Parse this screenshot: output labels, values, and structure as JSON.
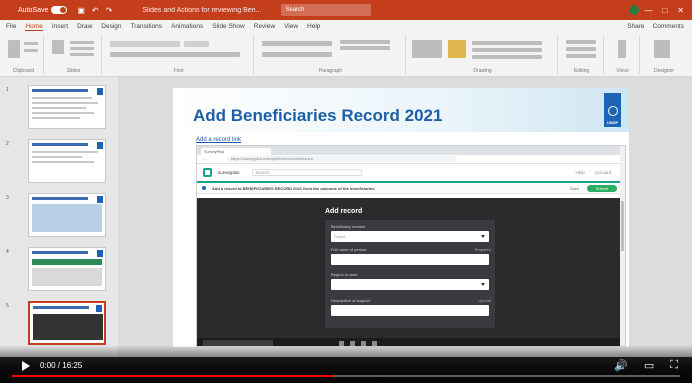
{
  "app": {
    "title_bar": {
      "autosave_label": "AutoSave",
      "document_title": "Slides and Actions for reviewing Ben...",
      "search_placeholder": "Search"
    },
    "menu": {
      "items": [
        "File",
        "Home",
        "Insert",
        "Draw",
        "Design",
        "Transitions",
        "Animations",
        "Slide Show",
        "Review",
        "View",
        "Help"
      ],
      "active_index": 1,
      "share_label": "Share",
      "comments_label": "Comments"
    },
    "ribbon_groups": [
      "Clipboard",
      "Slides",
      "Font",
      "Paragraph",
      "Drawing",
      "Editing",
      "Voice",
      "Designer"
    ]
  },
  "slide_panel": {
    "thumbnails": [
      {
        "number": "1"
      },
      {
        "number": "2"
      },
      {
        "number": "3"
      },
      {
        "number": "4"
      },
      {
        "number": "5",
        "selected": true
      }
    ]
  },
  "slide": {
    "title": "Add Beneficiaries Record 2021",
    "link_text": "Add a record link",
    "logo_text": "UNDP",
    "browser": {
      "tab_label": "SurveyPlus",
      "url": "https://surveyplus.example/forms/beneficiaries",
      "site_name": "surveyplus",
      "search_placeholder": "Search",
      "header_links": [
        "Help",
        "Account"
      ],
      "subheader_title": "Add a record to BENEFICIARIES RECORD 2021 from the outcome of the beneficiaries",
      "back_label": "Back",
      "submit_label": "Submit",
      "modal": {
        "title": "Add record",
        "fields": [
          {
            "label": "Beneficiary number",
            "value": "Select",
            "type": "select"
          },
          {
            "label": "Full name of person",
            "hint": "Required",
            "value": "",
            "type": "text"
          },
          {
            "label": "Region or area",
            "value": "",
            "type": "select"
          },
          {
            "label": "Description of support",
            "hint": "Upload",
            "value": "",
            "type": "text"
          }
        ]
      }
    }
  },
  "video": {
    "timecode": "0:00 / 16:25",
    "progress_fraction": 0.48,
    "controls": [
      "volume-icon",
      "captions-icon",
      "fullscreen-icon"
    ]
  }
}
